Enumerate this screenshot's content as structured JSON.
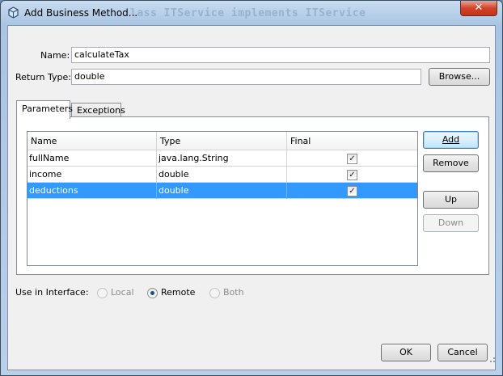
{
  "window": {
    "title": "Add Business Method...",
    "background_code": "lass ITService implements ITService",
    "close_glyph": "✕"
  },
  "name_field": {
    "label": "Name:",
    "value": "calculateTax"
  },
  "return_type_field": {
    "label": "Return Type:",
    "value": "double",
    "browse_label": "Browse..."
  },
  "tabs": [
    {
      "label": "Parameters",
      "active": true
    },
    {
      "label": "Exceptions",
      "active": false
    }
  ],
  "parameters_table": {
    "columns": [
      "Name",
      "Type",
      "Final"
    ],
    "rows": [
      {
        "name": "fullName",
        "type": "java.lang.String",
        "final": true,
        "selected": false
      },
      {
        "name": "income",
        "type": "double",
        "final": true,
        "selected": false
      },
      {
        "name": "deductions",
        "type": "double",
        "final": true,
        "selected": true
      }
    ]
  },
  "table_buttons": {
    "add": "Add",
    "remove": "Remove",
    "up": "Up",
    "down": "Down"
  },
  "interface": {
    "label": "Use in Interface:",
    "options": [
      {
        "label": "Local",
        "checked": false,
        "enabled": false
      },
      {
        "label": "Remote",
        "checked": true,
        "enabled": true
      },
      {
        "label": "Both",
        "checked": false,
        "enabled": false
      }
    ]
  },
  "dialog_buttons": {
    "ok": "OK",
    "cancel": "Cancel"
  },
  "colors": {
    "selection": "#3399ff",
    "title_gradient": "#a9c5e3",
    "close_red": "#d2432a"
  },
  "icons": {
    "title": "bean-icon",
    "close": "close-icon",
    "check": "checkmark-icon"
  }
}
